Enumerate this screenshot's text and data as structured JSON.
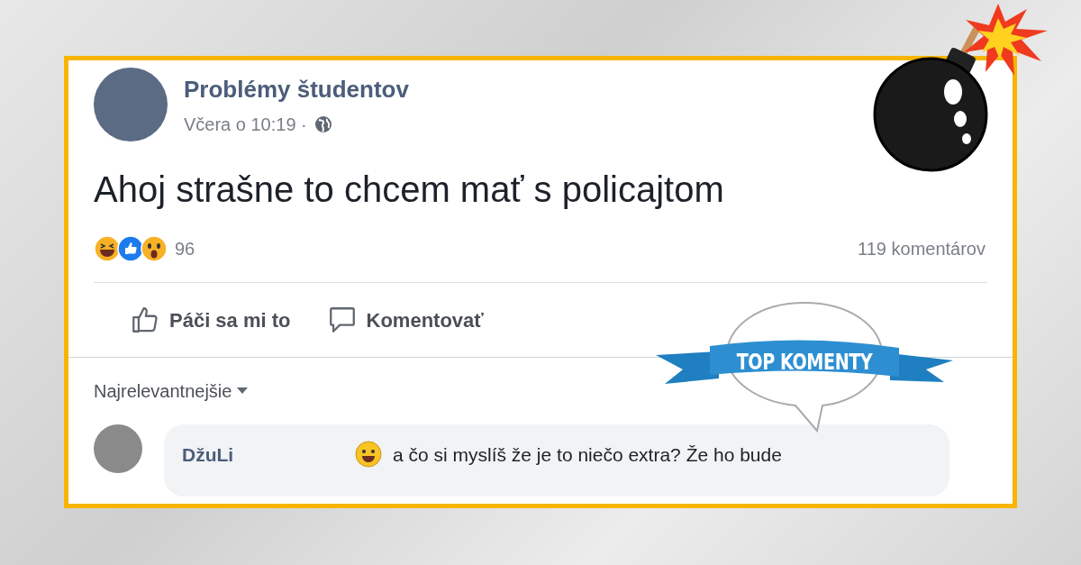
{
  "post": {
    "author": "Problémy študentov",
    "time": "Včera o 10:19 ·",
    "text": "Ahoj strašne to chcem mať s policajtom",
    "reaction_count": "96",
    "comment_count": "119 komentárov"
  },
  "actions": [
    {
      "kind": "like",
      "label": "Páči sa mi to"
    },
    {
      "kind": "comment",
      "label": "Komentovať"
    }
  ],
  "sort": {
    "label": "Najrelevantnejšie"
  },
  "badge": {
    "label": "TOP KOMENTY"
  },
  "comments": [
    {
      "author": "DžuLi",
      "text": "a čo si myslíš že je to niečo extra? Že ho bude"
    }
  ]
}
